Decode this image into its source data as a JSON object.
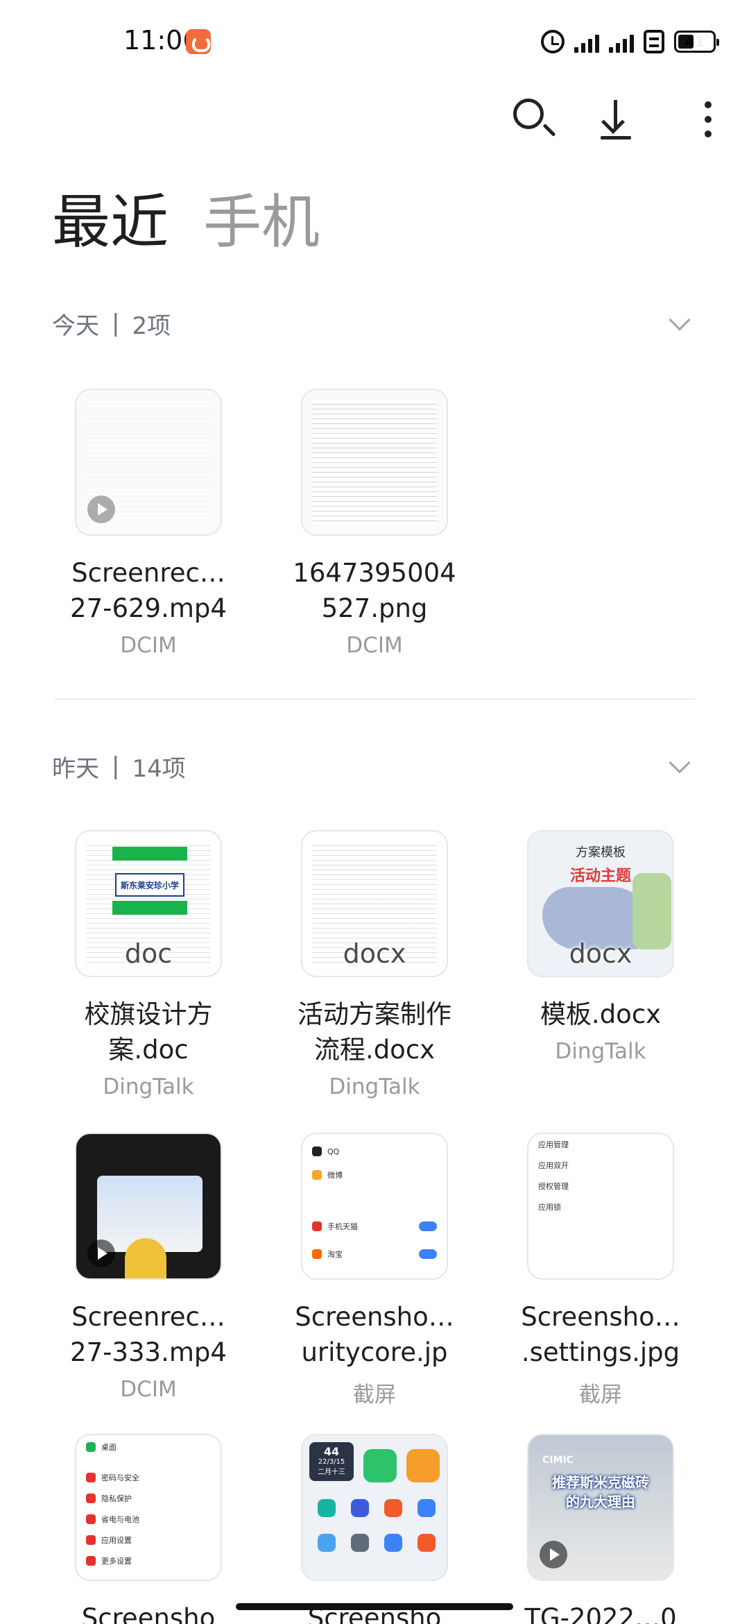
{
  "status_bar": {
    "time": "11:06",
    "battery": "41"
  },
  "tabs": {
    "recent": "最近",
    "phone": "手机"
  },
  "sections": [
    {
      "label": "今天",
      "count": "2项"
    },
    {
      "label": "昨天",
      "count": "14项"
    }
  ],
  "today_files": [
    {
      "name": "Screenrec…\n27-629.mp4",
      "source": "DCIM",
      "type": "video"
    },
    {
      "name": "1647395004\n527.png",
      "source": "DCIM",
      "type": "image"
    }
  ],
  "yesterday_files": [
    {
      "name": "校旗设计方\n案.doc",
      "source": "DingTalk",
      "type": "doc",
      "ext": "doc"
    },
    {
      "name": "活动方案制作\n流程.docx",
      "source": "DingTalk",
      "type": "doc",
      "ext": "docx"
    },
    {
      "name": "模板.docx",
      "source": "DingTalk",
      "type": "doc",
      "ext": "docx"
    },
    {
      "name": "Screenrec…\n27-333.mp4",
      "source": "DCIM",
      "type": "video"
    },
    {
      "name": "Screensho…\nuritycore.jp",
      "source": "截屏",
      "type": "image"
    },
    {
      "name": "Screensho…\n.settings.jpg",
      "source": "截屏",
      "type": "image"
    },
    {
      "name": "Screensho",
      "source": "",
      "type": "image"
    },
    {
      "name": "Screensho",
      "source": "",
      "type": "image"
    },
    {
      "name": "TG-2022…0",
      "source": "",
      "type": "video"
    }
  ],
  "thumb_text": {
    "school_logo": "斯东莱安珍小学",
    "template_title": "方案模板",
    "template_red": "活动主题",
    "settings_qq": "QQ",
    "settings_weibo": "微博",
    "settings_tmall": "手机天猫",
    "settings_taobao": "淘宝",
    "settings2_a": "应用管理",
    "settings2_b": "应用双开",
    "settings2_c": "授权管理",
    "settings2_d": "应用锁",
    "settings3_a": "桌面",
    "settings3_b": "密码与安全",
    "settings3_c": "隐私保护",
    "settings3_d": "省电与电池",
    "settings3_e": "应用设置",
    "settings3_f": "更多设置",
    "calendar_day": "44",
    "calendar_date": "22/3/15",
    "calendar_lunar": "二月十三",
    "ad_brand": "CIMIC",
    "ad_line1": "推荐斯米克磁砖",
    "ad_line2": "的九大理由"
  },
  "colors": {
    "accent_green": "#18b34a",
    "toggle_blue": "#3b82f6",
    "muted_text": "#9a9a9a"
  },
  "icons": [
    "search-icon",
    "download-icon",
    "more-icon",
    "chevron-down-icon",
    "play-icon",
    "alarm-icon",
    "battery-icon"
  ]
}
